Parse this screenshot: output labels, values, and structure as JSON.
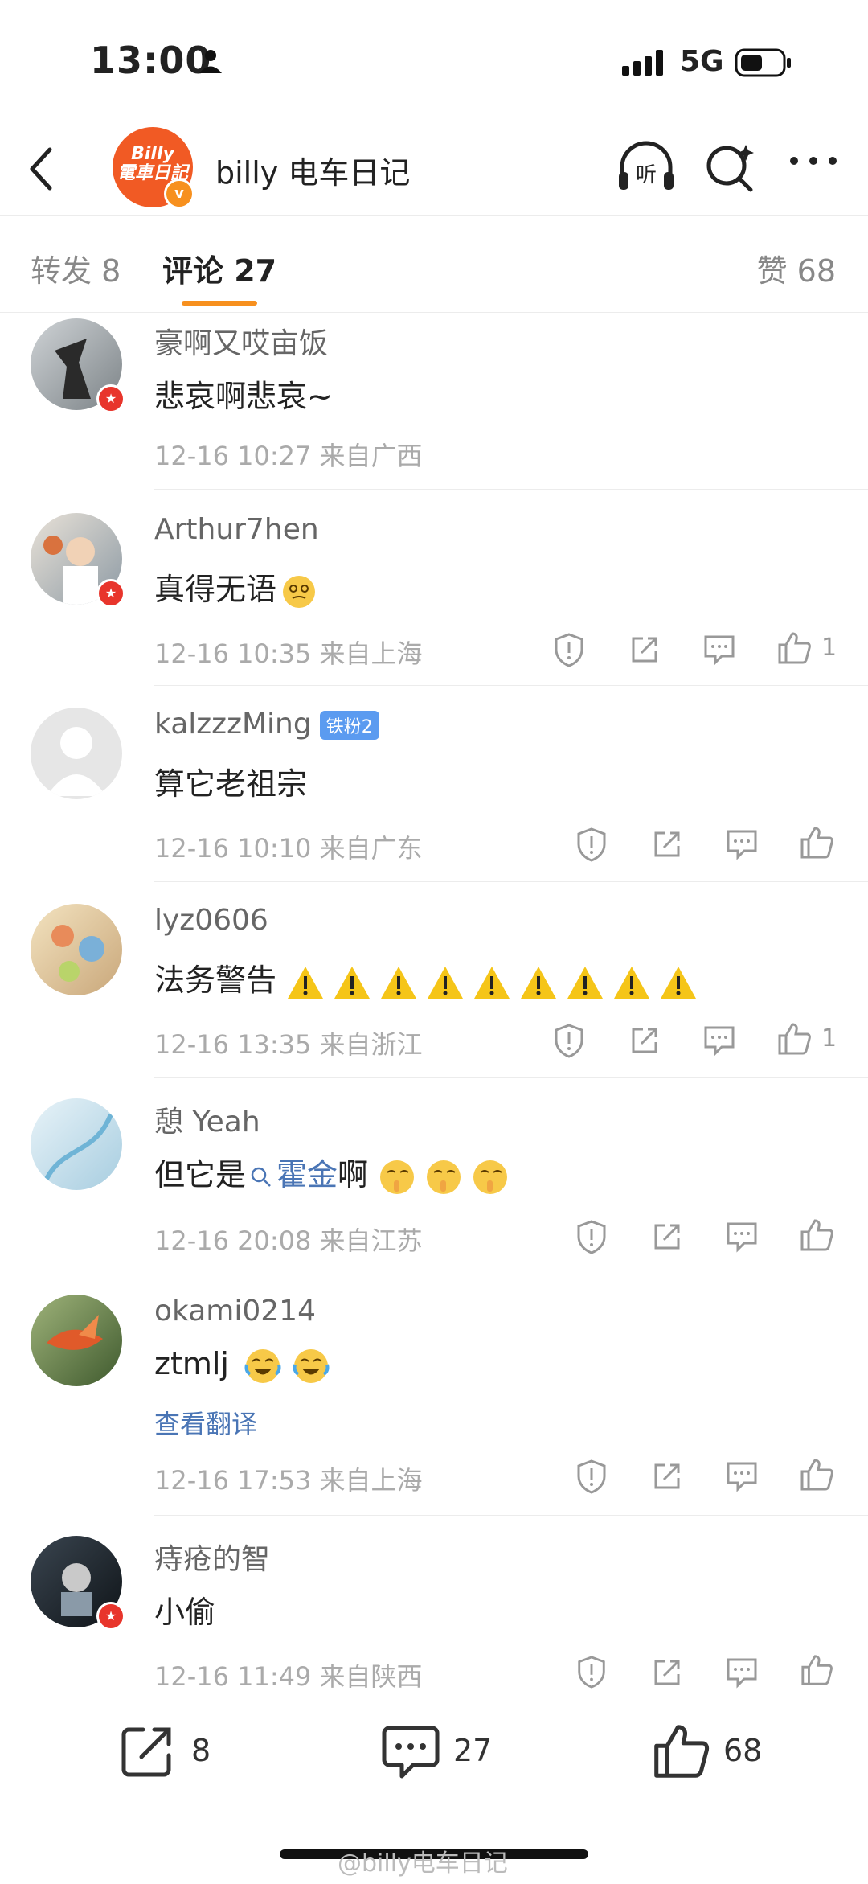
{
  "status": {
    "time": "13:00",
    "network": "5G"
  },
  "header": {
    "title": "billy 电车日记",
    "avatar_text": "Billy\n電車日記",
    "listen_label": "听"
  },
  "tabs": {
    "repost": "转发 8",
    "comments": "评论 27",
    "likes": "赞 68"
  },
  "comments": [
    {
      "name": "豪啊又哎亩饭",
      "text": "悲哀啊悲哀~",
      "meta": "12-16 10:27 来自广西",
      "likes": ""
    },
    {
      "name": "Arthur7hen",
      "text": "真得无语",
      "meta": "12-16 10:35 来自上海",
      "likes": "1"
    },
    {
      "name": "kalzzzMing",
      "badge": "铁粉2",
      "text": "算它老祖宗",
      "meta": "12-16 10:10 来自广东",
      "likes": ""
    },
    {
      "name": "lyz0606",
      "text": "法务警告",
      "meta": "12-16 13:35 来自浙江",
      "likes": "1"
    },
    {
      "name": "憩 Yeah",
      "text_pre": "但它是",
      "hashtag": "霍金",
      "text_post": "啊",
      "meta": "12-16 20:08 来自江苏",
      "likes": ""
    },
    {
      "name": "okami0214",
      "text": "ztmlj",
      "translate": "查看翻译",
      "meta": "12-16 17:53 来自上海",
      "likes": ""
    },
    {
      "name": "痔疮的智",
      "text": "小偷",
      "meta": "12-16 11:49 来自陕西",
      "likes": ""
    }
  ],
  "bottom": {
    "repost_count": "8",
    "comment_count": "27",
    "like_count": "68"
  },
  "watermark": "@billy电车日记",
  "colors": {
    "accent": "#f7901e",
    "link": "#4a75b5",
    "vip_badge": "#e8352c",
    "fan_badge": "#5b9bf0"
  }
}
